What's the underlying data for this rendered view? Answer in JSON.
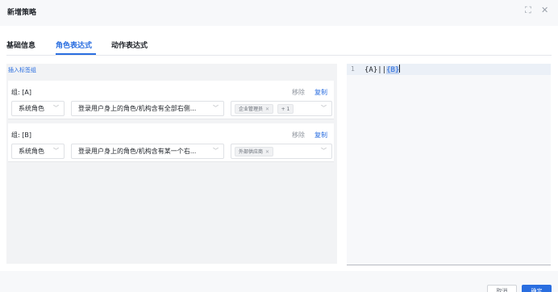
{
  "dialog": {
    "title": "新增策略",
    "expand_icon": "expand-icon",
    "close_icon": "close-icon"
  },
  "tabs": [
    {
      "label": "基础信息",
      "active": false
    },
    {
      "label": "角色表达式",
      "active": true
    },
    {
      "label": "动作表达式",
      "active": false
    }
  ],
  "left": {
    "insert_label": "插入标签组",
    "groups": [
      {
        "label": "组: [A]",
        "remove": "移除",
        "copy": "复制",
        "type_value": "系统角色",
        "rule_value": "登录用户身上的角色/机构含有全部右侧...",
        "tags": [
          "企业管理员"
        ],
        "more": "+ 1"
      },
      {
        "label": "组: [B]",
        "remove": "移除",
        "copy": "复制",
        "type_value": "系统角色",
        "rule_value": "登录用户身上的角色/机构含有某一个右...",
        "tags": [
          "外部供应商"
        ]
      }
    ]
  },
  "editor": {
    "line_number": "1",
    "code_prefix": "{A}||",
    "code_highlight": "{B}"
  },
  "footer": {
    "cancel_label": "取消",
    "ok_label": "确定"
  },
  "colors": {
    "accent": "#2a6ee0"
  }
}
